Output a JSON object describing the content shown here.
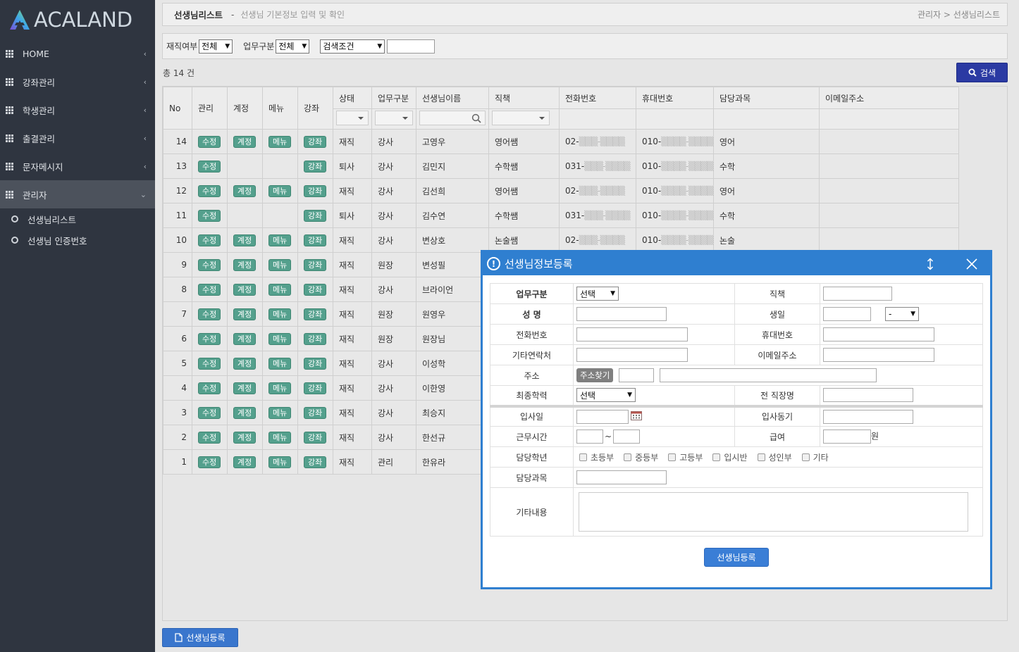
{
  "app": {
    "logo_text": "ACALAND",
    "brand_color": "#2f3540",
    "accent_color": "#2f7fd0"
  },
  "sidebar": {
    "items": [
      {
        "label": "HOME",
        "icon": "grid-icon",
        "chevron": "‹"
      },
      {
        "label": "강좌관리",
        "icon": "grid-icon",
        "chevron": "‹"
      },
      {
        "label": "학생관리",
        "icon": "grid-icon",
        "chevron": "‹"
      },
      {
        "label": "출결관리",
        "icon": "grid-icon",
        "chevron": "‹"
      },
      {
        "label": "문자메시지",
        "icon": "grid-icon",
        "chevron": "‹"
      },
      {
        "label": "관리자",
        "icon": "grid-icon",
        "chevron": "⌄",
        "active": true
      }
    ],
    "subitems": [
      {
        "label": "선생님리스트"
      },
      {
        "label": "선생님 인증번호"
      }
    ]
  },
  "header": {
    "title": "선생님리스트",
    "separator": "-",
    "description": "선생님 기본정보 입력 및 확인",
    "breadcrumb": "관리자 > 선생님리스트"
  },
  "filter": {
    "employment_label": "재직여부",
    "employment_value": "전체",
    "work_label": "업무구분",
    "work_value": "전체",
    "condition_value": "검색조건",
    "search_text": ""
  },
  "total_text": "총 14 건",
  "search_button": "검색",
  "table": {
    "headers": [
      "No",
      "관리",
      "계정",
      "메뉴",
      "강좌",
      "상태",
      "업무구분",
      "선생님이름",
      "직책",
      "전화번호",
      "휴대번호",
      "담당과목",
      "이메일주소"
    ],
    "badges": {
      "edit": "수정",
      "account": "계정",
      "menu": "메뉴",
      "course": "강좌"
    },
    "rows": [
      {
        "no": "14",
        "acct": true,
        "menu": true,
        "status": "재직",
        "work": "강사",
        "name": "고영우",
        "role": "영어쌤",
        "phone_prefix": "02-",
        "phone_blur": "▒▒▒-▒▒▒▒",
        "mobile_prefix": "010-",
        "mobile_blur": "▒▒▒▒-▒▒▒▒",
        "subject": "영어",
        "email": ""
      },
      {
        "no": "13",
        "acct": false,
        "menu": false,
        "status": "퇴사",
        "work": "강사",
        "name": "김민지",
        "role": "수학쌤",
        "phone_prefix": "031-",
        "phone_blur": "▒▒▒-▒▒▒▒",
        "mobile_prefix": "010-",
        "mobile_blur": "▒▒▒▒-▒▒▒▒",
        "subject": "수학",
        "email": ""
      },
      {
        "no": "12",
        "acct": true,
        "menu": true,
        "status": "재직",
        "work": "강사",
        "name": "김선희",
        "role": "영어쌤",
        "phone_prefix": "02-",
        "phone_blur": "▒▒▒-▒▒▒▒",
        "mobile_prefix": "010-",
        "mobile_blur": "▒▒▒▒-▒▒▒▒",
        "subject": "영어",
        "email": ""
      },
      {
        "no": "11",
        "acct": false,
        "menu": false,
        "status": "퇴사",
        "work": "강사",
        "name": "김수연",
        "role": "수학쌤",
        "phone_prefix": "031-",
        "phone_blur": "▒▒▒-▒▒▒▒",
        "mobile_prefix": "010-",
        "mobile_blur": "▒▒▒▒-▒▒▒▒",
        "subject": "수학",
        "email": ""
      },
      {
        "no": "10",
        "acct": true,
        "menu": true,
        "status": "재직",
        "work": "강사",
        "name": "변상호",
        "role": "논술쌤",
        "phone_prefix": "02-",
        "phone_blur": "▒▒▒-▒▒▒▒",
        "mobile_prefix": "010-",
        "mobile_blur": "▒▒▒▒-▒▒▒▒",
        "subject": "논술",
        "email": ""
      },
      {
        "no": "9",
        "acct": true,
        "menu": true,
        "status": "재직",
        "work": "원장",
        "name": "변성필",
        "role": "",
        "phone_prefix": "",
        "phone_blur": "",
        "mobile_prefix": "",
        "mobile_blur": "",
        "subject": "",
        "email": ""
      },
      {
        "no": "8",
        "acct": true,
        "menu": true,
        "status": "재직",
        "work": "강사",
        "name": "브라이언",
        "role": "",
        "phone_prefix": "",
        "phone_blur": "",
        "mobile_prefix": "",
        "mobile_blur": "",
        "subject": "",
        "email": ""
      },
      {
        "no": "7",
        "acct": true,
        "menu": true,
        "status": "재직",
        "work": "원장",
        "name": "원영우",
        "role": "",
        "phone_prefix": "",
        "phone_blur": "",
        "mobile_prefix": "",
        "mobile_blur": "",
        "subject": "",
        "email": ""
      },
      {
        "no": "6",
        "acct": true,
        "menu": true,
        "status": "재직",
        "work": "원장",
        "name": "원장님",
        "role": "",
        "phone_prefix": "",
        "phone_blur": "",
        "mobile_prefix": "",
        "mobile_blur": "",
        "subject": "",
        "email": ""
      },
      {
        "no": "5",
        "acct": true,
        "menu": true,
        "status": "재직",
        "work": "강사",
        "name": "이성학",
        "role": "",
        "phone_prefix": "",
        "phone_blur": "",
        "mobile_prefix": "",
        "mobile_blur": "",
        "subject": "",
        "email": ""
      },
      {
        "no": "4",
        "acct": true,
        "menu": true,
        "status": "재직",
        "work": "강사",
        "name": "이한영",
        "role": "",
        "phone_prefix": "",
        "phone_blur": "",
        "mobile_prefix": "",
        "mobile_blur": "",
        "subject": "",
        "email": ""
      },
      {
        "no": "3",
        "acct": true,
        "menu": true,
        "status": "재직",
        "work": "강사",
        "name": "최승지",
        "role": "",
        "phone_prefix": "",
        "phone_blur": "",
        "mobile_prefix": "",
        "mobile_blur": "",
        "subject": "",
        "email": ""
      },
      {
        "no": "2",
        "acct": true,
        "menu": true,
        "status": "재직",
        "work": "강사",
        "name": "한선규",
        "role": "",
        "phone_prefix": "",
        "phone_blur": "",
        "mobile_prefix": "",
        "mobile_blur": "",
        "subject": "",
        "email": ""
      },
      {
        "no": "1",
        "acct": true,
        "menu": true,
        "status": "재직",
        "work": "관리",
        "name": "한유라",
        "role": "",
        "phone_prefix": "",
        "phone_blur": "",
        "mobile_prefix": "",
        "mobile_blur": "",
        "subject": "",
        "email": ""
      }
    ]
  },
  "bottom_button": "선생님등록",
  "modal": {
    "title": "선생님정보등록",
    "fields": {
      "work_type": "업무구분",
      "work_type_value": "선택",
      "position": "직책",
      "name": "성 명",
      "birthday": "생일",
      "birthday_select": "-",
      "phone": "전화번호",
      "mobile": "휴대번호",
      "other_contact": "기타연락처",
      "email": "이메일주소",
      "address": "주소",
      "address_button": "주소찾기",
      "education": "최종학력",
      "education_value": "선택",
      "prev_job": "전 직장명",
      "join_date": "입사일",
      "join_reason": "입사동기",
      "work_hours": "근무시간",
      "tilde": "~",
      "salary": "급여",
      "salary_unit": "원",
      "grade": "담당학년",
      "subject": "담당과목",
      "notes": "기타내용"
    },
    "grades": [
      "초등부",
      "중등부",
      "고등부",
      "입시반",
      "성인부",
      "기타"
    ],
    "submit": "선생님등록"
  }
}
